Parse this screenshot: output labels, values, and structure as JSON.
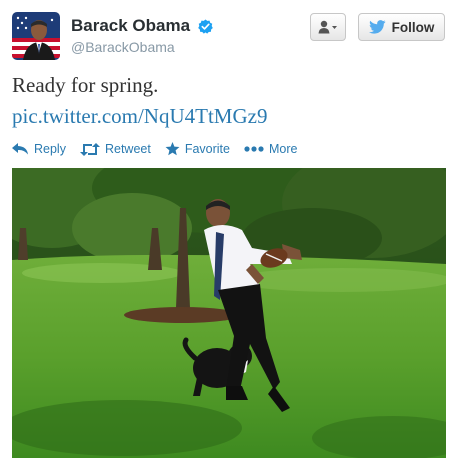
{
  "user": {
    "full_name": "Barack Obama",
    "screen_name": "@BarackObama",
    "verified": true
  },
  "buttons": {
    "user_menu_icon": "person-icon",
    "follow_label": "Follow"
  },
  "tweet": {
    "text": "Ready for spring.",
    "link": "pic.twitter.com/NqU4TtMGz9"
  },
  "actions": [
    {
      "label": "Reply",
      "icon": "reply-icon"
    },
    {
      "label": "Retweet",
      "icon": "retweet-icon"
    },
    {
      "label": "Favorite",
      "icon": "star-icon"
    },
    {
      "label": "More",
      "icon": "more-dots-icon"
    }
  ],
  "colors": {
    "link": "#2a7ab0",
    "verified_badge": "#1da1f2",
    "twitter_bird": "#55acee"
  }
}
